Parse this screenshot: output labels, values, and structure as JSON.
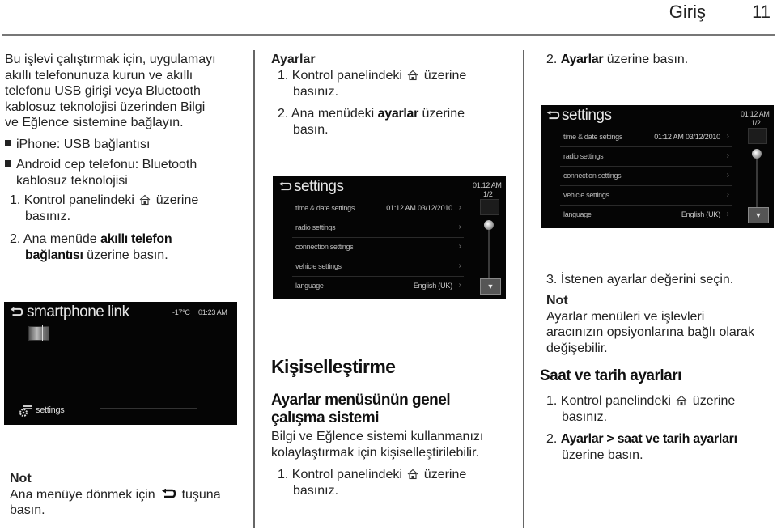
{
  "header": {
    "section_title": "Giriş",
    "page_number": "11"
  },
  "col1": {
    "intro": "Bu işlevi çalıştırmak için, uygulamayı akıllı telefonunuza kurun ve akıllı telefonu USB girişi veya Bluetooth kablosuz teknolojisi üzerinden Bilgi ve Eğlence sistemine bağlayın.",
    "intro_lines": [
      "Bu işlevi çalıştırmak için, uygulamayı",
      "akıllı telefonunuza kurun ve akıllı",
      "telefonu USB girişi veya Bluetooth",
      "kablosuz teknolojisi üzerinden Bilgi",
      "ve Eğlence sistemine bağlayın."
    ],
    "bullets": [
      {
        "lines": [
          "iPhone: USB bağlantısı"
        ]
      },
      {
        "lines": [
          "Android cep telefonu: Bluetooth",
          "kablosuz teknolojisi"
        ]
      }
    ],
    "steps": [
      {
        "num": "1.",
        "pre": "Kontrol panelindeki",
        "post": "üzerine",
        "line2": "basınız.",
        "icon": "home-icon"
      },
      {
        "num": "2.",
        "pre": "Ana menüde",
        "bold": "akıllı telefon",
        "bold2": "bağlantısı",
        "post": "üzerine basın."
      }
    ],
    "screen": {
      "title": "smartphone link",
      "temperature": "-17°C",
      "time": "01:23 AM",
      "settings_label": "settings"
    },
    "note": {
      "title": "Not",
      "pre": "Ana menüye dönmek için",
      "post": "tuşuna",
      "line2": "basın.",
      "icon": "back-arrow-icon"
    }
  },
  "col2": {
    "heading": "Ayarlar",
    "steps": [
      {
        "num": "1.",
        "pre": "Kontrol panelindeki",
        "post": "üzerine",
        "line2": "basınız.",
        "icon": "home-icon"
      },
      {
        "num": "2.",
        "pre": "Ana menüdeki",
        "bold": "ayarlar",
        "post": "üzerine",
        "line2": "basın."
      }
    ],
    "screen": {
      "title": "settings",
      "time": "01:12 AM",
      "page_indicator": "1/2",
      "rows": [
        {
          "label": "time & date settings",
          "value": "01:12 AM   03/12/2010"
        },
        {
          "label": "radio settings",
          "value": ""
        },
        {
          "label": "connection settings",
          "value": ""
        },
        {
          "label": "vehicle settings",
          "value": ""
        },
        {
          "label": "language",
          "value": "English (UK)"
        }
      ]
    },
    "section_title": "Kişiselleştirme",
    "subsection_title_lines": [
      "Ayarlar menüsünün genel",
      "çalışma sistemi"
    ],
    "body_lines": [
      "Bilgi ve Eğlence sistemi kullanmanızı",
      "kolaylaştırmak için kişiselleştirilebilir."
    ],
    "step_after": {
      "num": "1.",
      "pre": "Kontrol panelindeki",
      "post": "üzerine",
      "line2": "basınız.",
      "icon": "home-icon"
    }
  },
  "col3": {
    "step2": {
      "num": "2.",
      "bold": "Ayarlar",
      "post": "üzerine basın."
    },
    "screen": {
      "title": "settings",
      "time": "01:12 AM",
      "page_indicator": "1/2",
      "rows": [
        {
          "label": "time & date settings",
          "value": "01:12 AM   03/12/2010"
        },
        {
          "label": "radio settings",
          "value": ""
        },
        {
          "label": "connection settings",
          "value": ""
        },
        {
          "label": "vehicle settings",
          "value": ""
        },
        {
          "label": "language",
          "value": "English (UK)"
        }
      ]
    },
    "step3": {
      "num": "3.",
      "text": "İstenen ayarlar değerini seçin."
    },
    "note": {
      "title": "Not",
      "lines": [
        "Ayarlar menüleri ve işlevleri",
        "aracınızın opsiyonlarına bağlı olarak",
        "değişebilir."
      ]
    },
    "section_title": "Saat ve tarih ayarları",
    "steps": [
      {
        "num": "1.",
        "pre": "Kontrol panelindeki",
        "post": "üzerine",
        "line2": "basınız.",
        "icon": "home-icon"
      },
      {
        "num": "2.",
        "bold": "Ayarlar > saat ve tarih ayarları",
        "line2": "üzerine basın."
      }
    ]
  }
}
